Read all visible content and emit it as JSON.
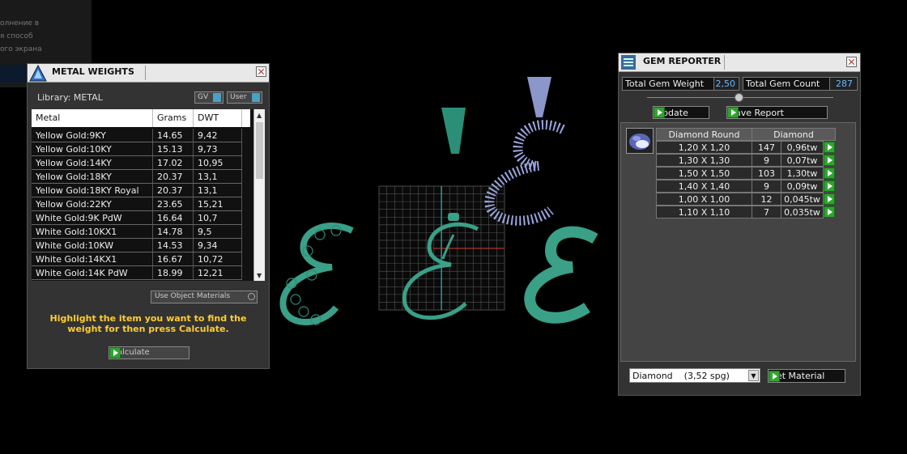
{
  "background": {
    "ghost_lines": [
      "олнение в",
      "я способ",
      "ого экрана"
    ]
  },
  "metal_weights": {
    "title": "METAL WEIGHTS",
    "library_label": "Library: METAL",
    "gv_label": "GV",
    "user_label": "User",
    "columns": [
      "Metal",
      "Grams",
      "DWT"
    ],
    "rows": [
      {
        "metal": "Yellow Gold:9KY",
        "grams": "14.65",
        "dwt": "9,42"
      },
      {
        "metal": "Yellow Gold:10KY",
        "grams": "15.13",
        "dwt": "9,73"
      },
      {
        "metal": "Yellow Gold:14KY",
        "grams": "17.02",
        "dwt": "10,95"
      },
      {
        "metal": "Yellow Gold:18KY",
        "grams": "20.37",
        "dwt": "13,1"
      },
      {
        "metal": "Yellow Gold:18KY Royal",
        "grams": "20.37",
        "dwt": "13,1"
      },
      {
        "metal": "Yellow Gold:22KY",
        "grams": "23.65",
        "dwt": "15,21"
      },
      {
        "metal": "White Gold:9K PdW",
        "grams": "16.64",
        "dwt": "10,7"
      },
      {
        "metal": "White Gold:10KX1",
        "grams": "14.78",
        "dwt": "9,5"
      },
      {
        "metal": "White Gold:10KW",
        "grams": "14.53",
        "dwt": "9,34"
      },
      {
        "metal": "White Gold:14KX1",
        "grams": "16.67",
        "dwt": "10,72"
      },
      {
        "metal": "White Gold:14K PdW",
        "grams": "18.99",
        "dwt": "12,21"
      }
    ],
    "use_object_materials": "Use Object Materials",
    "instruction": "Highlight the item you want to find the weight for then press Calculate.",
    "calculate_label": "Calculate"
  },
  "gem_reporter": {
    "title": "GEM REPORTER",
    "total_weight_label": "Total Gem Weight",
    "total_weight_value": "2,50",
    "total_count_label": "Total Gem Count",
    "total_count_value": "287",
    "update_label": "Update",
    "save_report_label": "Save Report",
    "table_header_shape": "Diamond Round",
    "table_header_material": "Diamond",
    "rows": [
      {
        "size": "1,20 X 1,20",
        "count": "147",
        "weight": "0,96tw"
      },
      {
        "size": "1,30 X 1,30",
        "count": "9",
        "weight": "0,07tw"
      },
      {
        "size": "1,50 X 1,50",
        "count": "103",
        "weight": "1,30tw"
      },
      {
        "size": "1,40 X 1,40",
        "count": "9",
        "weight": "0,09tw"
      },
      {
        "size": "1,00 X 1,00",
        "count": "12",
        "weight": "0,045tw"
      },
      {
        "size": "1,10 X 1,10",
        "count": "7",
        "weight": "0,035tw"
      }
    ],
    "material_select": "Diamond    (3,52 spg)",
    "set_material_label": "Set Material"
  },
  "colors": {
    "jade": "#3aa088",
    "gem_blue": "#9aa6e0",
    "highlight_text": "#ffcc33",
    "panel_bg": "#333333"
  }
}
